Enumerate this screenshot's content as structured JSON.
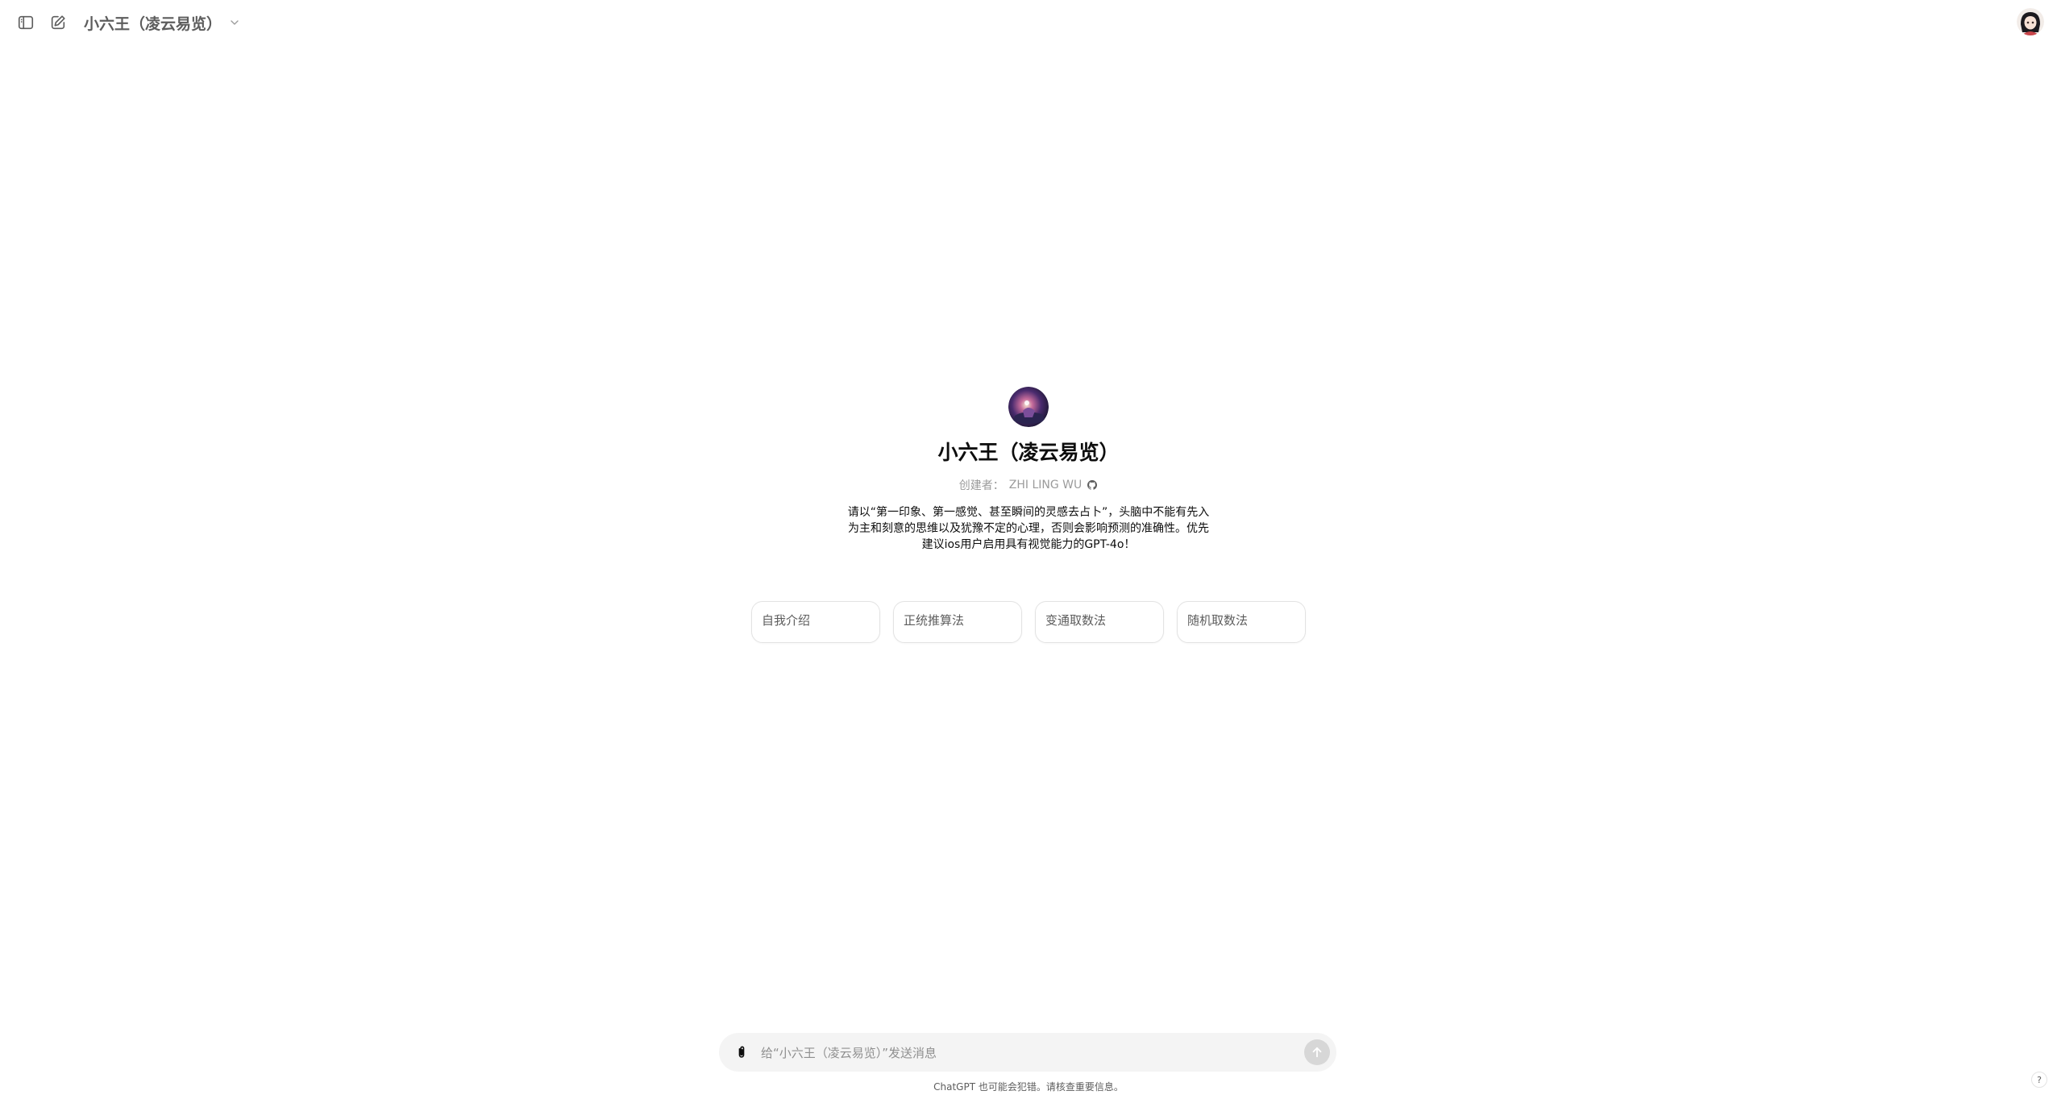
{
  "header": {
    "model_title": "小六王（凌云易览）",
    "icons": {
      "sidebar_toggle": "sidebar-toggle-icon",
      "new_chat": "edit-icon",
      "dropdown": "chevron-down-icon"
    }
  },
  "gpt": {
    "name": "小六王（凌云易览）",
    "creator_label": "创建者：",
    "creator_name": "ZHI LING WU",
    "creator_link_icon": "github-icon",
    "description": "请以“第一印象、第一感觉、甚至瞬间的灵感去占卜”，头脑中不能有先入为主和刻意的思维以及犹豫不定的心理，否则会影响预测的准确性。优先建议ios用户启用具有视觉能力的GPT-4o！"
  },
  "starters": [
    {
      "label": "自我介绍"
    },
    {
      "label": "正统推算法"
    },
    {
      "label": "变通取数法"
    },
    {
      "label": "随机取数法"
    }
  ],
  "composer": {
    "placeholder": "给“小六王（凌云易览）”发送消息",
    "value": "",
    "attach_icon": "paperclip-icon",
    "send_icon": "arrow-up-icon"
  },
  "footer": {
    "disclaimer": "ChatGPT 也可能会犯错。请核查重要信息。",
    "help_label": "?"
  },
  "colors": {
    "background": "#ffffff",
    "text_primary": "#0d0d0d",
    "text_secondary": "#5d5d5d",
    "composer_bg": "#f4f4f4",
    "send_button_disabled": "#d7d7d7"
  }
}
